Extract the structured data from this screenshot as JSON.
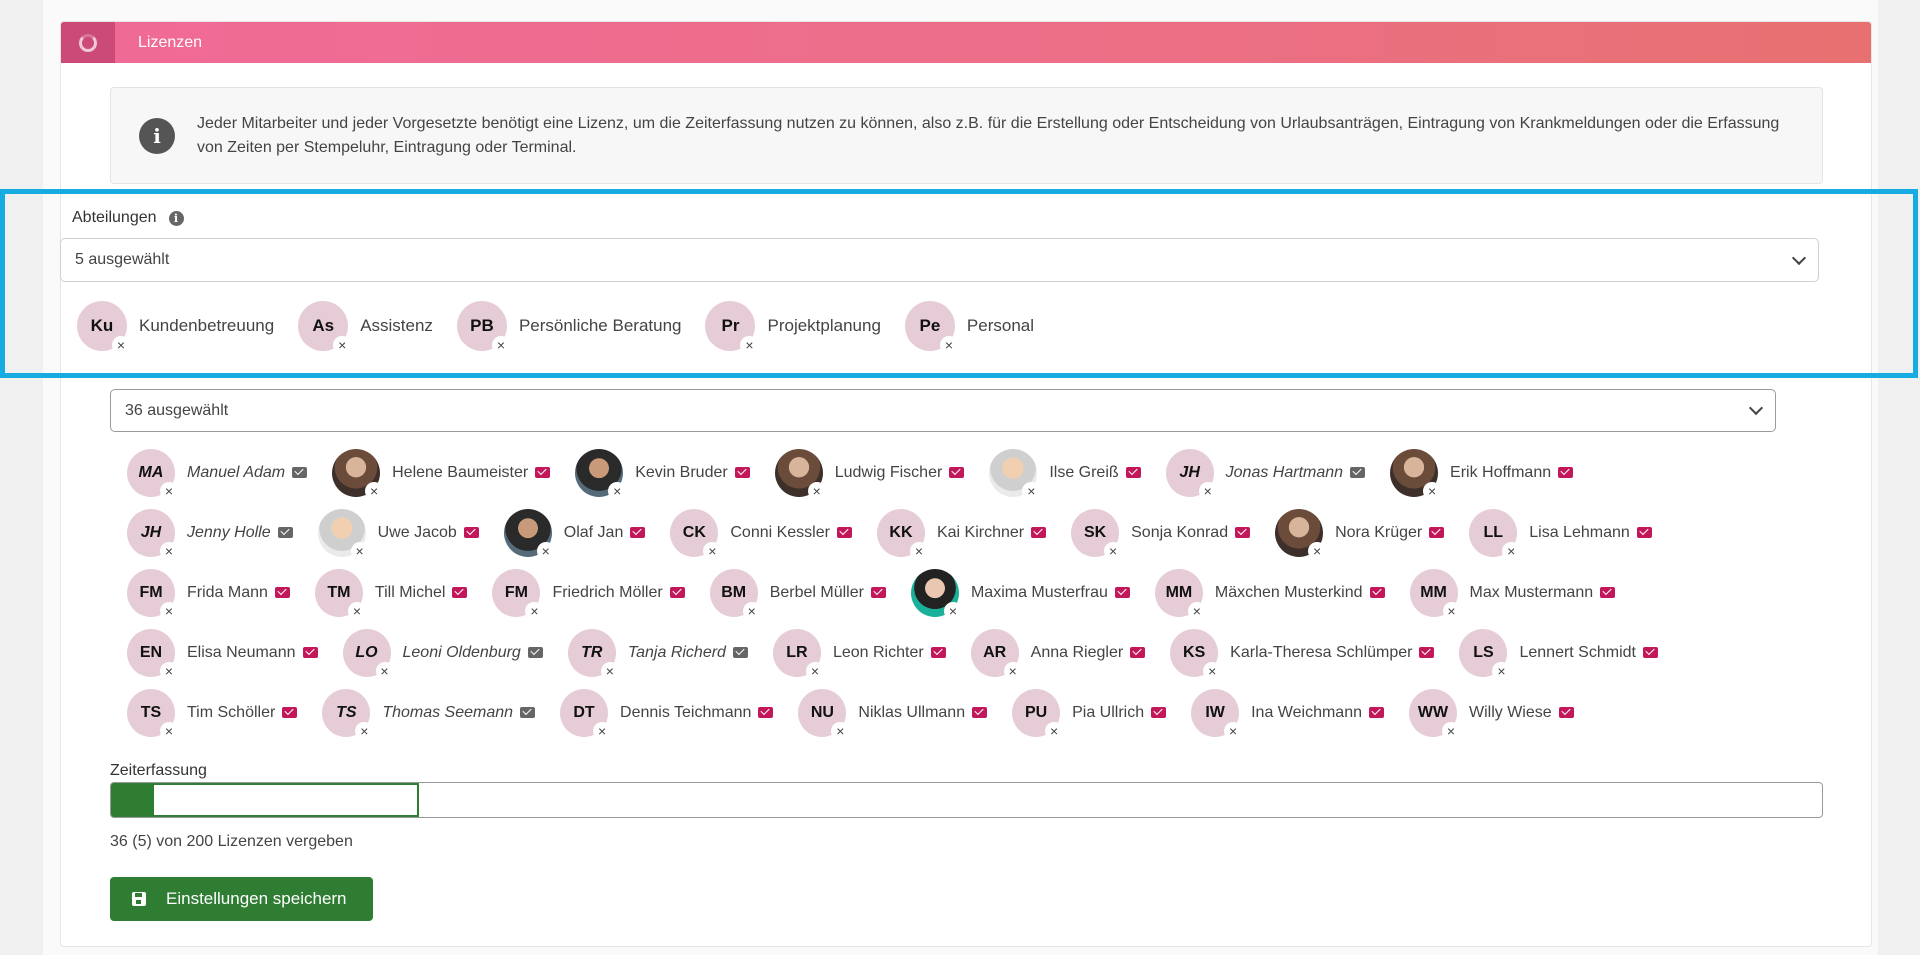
{
  "card": {
    "title": "Lizenzen",
    "header_icon": "spinner-ring-icon"
  },
  "info": {
    "icon": "info-icon",
    "text": "Jeder Mitarbeiter und jeder Vorgesetzte benötigt eine Lizenz, um die Zeiterfassung nutzen zu können, also z.B. für die Erstellung oder Entscheidung von Urlaubsanträgen, Eintragung von Krankmeldungen oder die Erfassung von Zeiten per Stempeluhr, Eintragung oder Terminal."
  },
  "departments": {
    "label": "Abteilungen",
    "selected_text": "5 ausgewählt",
    "items": [
      {
        "abbr": "Ku",
        "name": "Kundenbetreuung"
      },
      {
        "abbr": "As",
        "name": "Assistenz"
      },
      {
        "abbr": "PB",
        "name": "Persönliche Beratung"
      },
      {
        "abbr": "Pr",
        "name": "Projektplanung"
      },
      {
        "abbr": "Pe",
        "name": "Personal"
      }
    ]
  },
  "employees": {
    "selected_text": "36 ausgewählt",
    "rows": [
      [
        {
          "abbr": "MA",
          "name": "Manuel Adam",
          "italic": true,
          "mail": "grey"
        },
        {
          "abbr": "",
          "name": "Helene Baumeister",
          "photo": "photo",
          "mail": "pink"
        },
        {
          "abbr": "",
          "name": "Kevin Bruder",
          "photo": "photo3",
          "mail": "pink"
        },
        {
          "abbr": "",
          "name": "Ludwig Fischer",
          "photo": "photo",
          "mail": "pink"
        },
        {
          "abbr": "",
          "name": "Ilse Greiß",
          "photo": "photo2",
          "mail": "pink"
        },
        {
          "abbr": "JH",
          "name": "Jonas Hartmann",
          "italic": true,
          "mail": "grey"
        },
        {
          "abbr": "",
          "name": "Erik Hoffmann",
          "photo": "photo",
          "mail": "pink"
        }
      ],
      [
        {
          "abbr": "JH",
          "name": "Jenny Holle",
          "italic": true,
          "mail": "grey"
        },
        {
          "abbr": "",
          "name": "Uwe Jacob",
          "photo": "photo2",
          "mail": "pink"
        },
        {
          "abbr": "",
          "name": "Olaf Jan",
          "photo": "photo3",
          "mail": "pink"
        },
        {
          "abbr": "CK",
          "name": "Conni Kessler",
          "mail": "pink"
        },
        {
          "abbr": "KK",
          "name": "Kai Kirchner",
          "mail": "pink"
        },
        {
          "abbr": "SK",
          "name": "Sonja Konrad",
          "mail": "pink"
        },
        {
          "abbr": "",
          "name": "Nora Krüger",
          "photo": "photo",
          "mail": "pink"
        },
        {
          "abbr": "LL",
          "name": "Lisa Lehmann",
          "mail": "pink"
        }
      ],
      [
        {
          "abbr": "FM",
          "name": "Frida Mann",
          "mail": "pink"
        },
        {
          "abbr": "TM",
          "name": "Till Michel",
          "mail": "pink"
        },
        {
          "abbr": "FM",
          "name": "Friedrich Möller",
          "mail": "pink"
        },
        {
          "abbr": "BM",
          "name": "Berbel Müller",
          "mail": "pink"
        },
        {
          "abbr": "",
          "name": "Maxima Musterfrau",
          "photo": "photo4",
          "mail": "pink"
        },
        {
          "abbr": "MM",
          "name": "Mäxchen Musterkind",
          "mail": "pink"
        },
        {
          "abbr": "MM",
          "name": "Max Mustermann",
          "mail": "pink"
        }
      ],
      [
        {
          "abbr": "EN",
          "name": "Elisa Neumann",
          "mail": "pink"
        },
        {
          "abbr": "LO",
          "name": "Leoni Oldenburg",
          "italic": true,
          "mail": "grey"
        },
        {
          "abbr": "TR",
          "name": "Tanja Richerd",
          "italic": true,
          "mail": "grey"
        },
        {
          "abbr": "LR",
          "name": "Leon Richter",
          "mail": "pink"
        },
        {
          "abbr": "AR",
          "name": "Anna Riegler",
          "mail": "pink"
        },
        {
          "abbr": "KS",
          "name": "Karla-Theresa Schlümper",
          "mail": "pink"
        },
        {
          "abbr": "LS",
          "name": "Lennert Schmidt",
          "mail": "pink"
        }
      ],
      [
        {
          "abbr": "TS",
          "name": "Tim Schöller",
          "mail": "pink"
        },
        {
          "abbr": "TS",
          "name": "Thomas Seemann",
          "italic": true,
          "mail": "grey"
        },
        {
          "abbr": "DT",
          "name": "Dennis Teichmann",
          "mail": "pink"
        },
        {
          "abbr": "NU",
          "name": "Niklas Ullmann",
          "mail": "pink"
        },
        {
          "abbr": "PU",
          "name": "Pia Ullrich",
          "mail": "pink"
        },
        {
          "abbr": "IW",
          "name": "Ina Weichmann",
          "mail": "pink"
        },
        {
          "abbr": "WW",
          "name": "Willy Wiese",
          "mail": "pink"
        }
      ]
    ]
  },
  "zeiterfassung": {
    "label": "Zeiterfassung",
    "assigned": 36,
    "pending": 5,
    "total": 200,
    "license_text": "36 (5) von 200 Lizenzen vergeben",
    "fill_color": "#2e7d32"
  },
  "save_button": {
    "label": "Einstellungen speichern",
    "icon": "floppy-disk-icon"
  },
  "colors": {
    "accent": "#f06a97",
    "highlight": "#16ace2",
    "success": "#2e7d32",
    "mail": "#c2185b"
  }
}
